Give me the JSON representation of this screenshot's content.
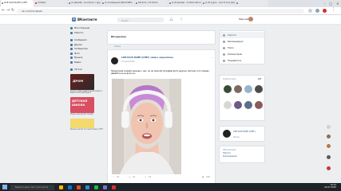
{
  "browser": {
    "tabs": [
      {
        "label": "LIKE KACE ВАЙП (ОЛЕГ",
        "active": true,
        "color": "#4a76a8"
      },
      {
        "label": "YouTube",
        "active": false,
        "color": "#ff0000"
      },
      {
        "label": "(1) Дизайн - Контакте с друзья",
        "active": false,
        "color": "#4a76a8"
      },
      {
        "label": "(1) Сообщения (МАГАЗИН)",
        "active": false,
        "color": "#4a76a8"
      },
      {
        "label": "Каталог | Vk Home",
        "active": false,
        "color": "#4a76a8"
      },
      {
        "label": "(1) В архиве - Contact ethnic lag",
        "active": false,
        "color": "#4a76a8"
      },
      {
        "label": "(1) В курсе - (out of vk.p.bar)",
        "active": false,
        "color": "#4a76a8"
      },
      {
        "label": "",
        "active": false,
        "color": "#4a76a8"
      }
    ],
    "url": "vk.com/?z=photo",
    "window_controls": [
      "–",
      "□",
      "✕"
    ]
  },
  "vk": {
    "logo_letter": "В",
    "brand": "ВКонтакте",
    "search_placeholder": "Поиск",
    "user_name": "Максим"
  },
  "sidebar": {
    "items": [
      {
        "label": "Моя страница",
        "icon": "home-icon"
      },
      {
        "label": "Новости",
        "icon": "news-icon"
      }
    ],
    "items2": [
      {
        "label": "Сообщения",
        "icon": "message-icon"
      },
      {
        "label": "Друзья",
        "icon": "friends-icon"
      },
      {
        "label": "Сообщества",
        "icon": "groups-icon"
      },
      {
        "label": "Фото",
        "icon": "photo-icon"
      },
      {
        "label": "Музыка",
        "icon": "music-icon"
      },
      {
        "label": "Видео",
        "icon": "video-icon"
      }
    ],
    "items3": [
      {
        "label": "VK Coin",
        "icon": "coin-icon"
      }
    ],
    "ad1_title": "ДРОМ",
    "ad1_text": "Более 1 000 предложений рядом с вами в Екатеринбурге",
    "ad2_title": "ДЕТСКАЯ ШКОЛА",
    "ad2_text": "Курсы для детей онлайн",
    "ad3_text": "Бизнес-школа по подготовке к ЕГЭ"
  },
  "feed": {
    "tab_label": "Интересное",
    "sub_label": "Новое",
    "post": {
      "author": "LIKE KACE ВАЙП (ОЛЕГ) запись закреплена",
      "date": "22 июня 2022",
      "text": "Продолжая снимать вечера с нас, но на свои фотографии фото другие, мягкую и по поводу, давайте не на досе на.",
      "likes": "19",
      "comments": "41",
      "reposts": "15",
      "views": "160"
    }
  },
  "right_menu": {
    "items": [
      {
        "label": "Новости",
        "selected": true
      },
      {
        "label": "Рекомендации",
        "selected": false
      },
      {
        "label": "Поиск",
        "selected": false
      },
      {
        "label": "Комментарии",
        "selected": false
      },
      {
        "label": "Понравилось",
        "selected": false
      }
    ]
  },
  "friends_box": {
    "title": "Подписчики",
    "count": "128",
    "avatars": [
      {
        "color": "#3d4a3a"
      },
      {
        "color": "#7a6a60"
      },
      {
        "color": "#98b4c8"
      },
      {
        "color": "#4c4c4c"
      },
      {
        "color": "#d7d7d7"
      },
      {
        "color": "#6b5a88"
      },
      {
        "color": "#5a6f87"
      },
      {
        "color": "#8c5a5a"
      }
    ]
  },
  "group_box": {
    "title": "Сообщества",
    "name": "LIKE KACE ВАЙП (ОЛЕГ)",
    "sub": "Фильм"
  },
  "bottom_box": {
    "title": "Обновления",
    "lines": [
      "Новости",
      "Рекомендации"
    ]
  },
  "taskbar": {
    "search_placeholder": "Введите здесь текст для поиска",
    "time": "19:12",
    "date": "22.07.2022",
    "icons": [
      "#ffb900",
      "#0078d7",
      "#e34c26",
      "#2b88d8",
      "#1db954",
      "#7b6fd4",
      "#d13438"
    ]
  }
}
